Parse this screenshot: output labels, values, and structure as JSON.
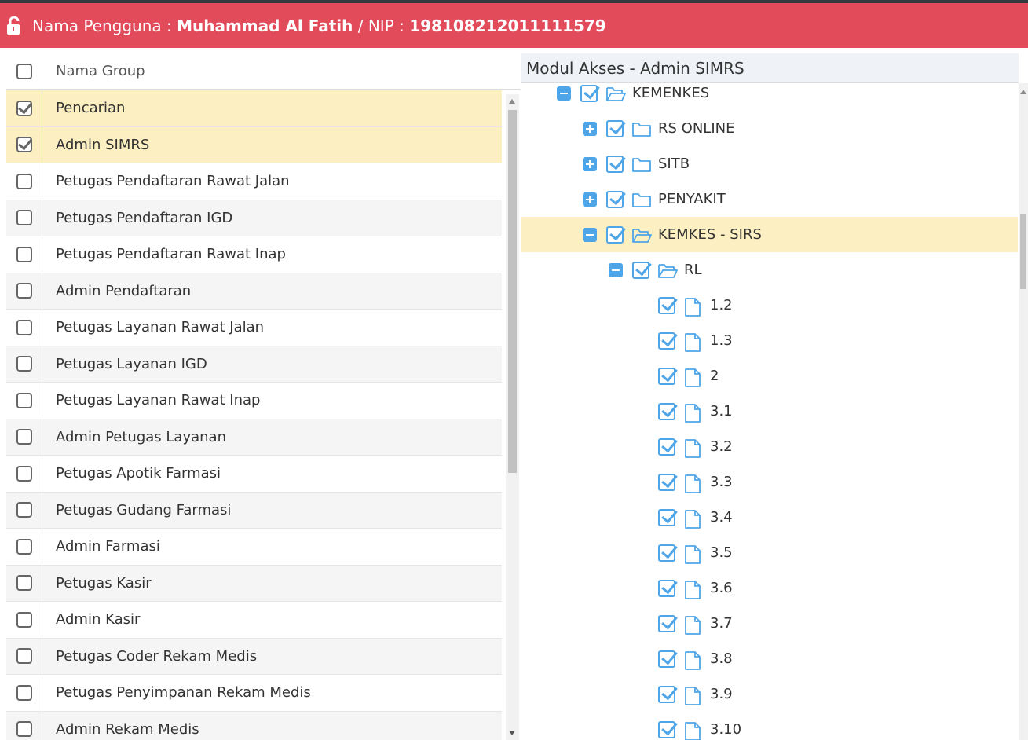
{
  "header": {
    "label_user": "Nama Pengguna : ",
    "user_name": "Muhammad Al Fatih",
    "label_nip": " / NIP : ",
    "nip": "198108212011111579",
    "brand_color": "#e14b5a"
  },
  "left": {
    "column_header": "Nama Group",
    "rows": [
      {
        "name": "Pencarian",
        "checked": true
      },
      {
        "name": "Admin SIMRS",
        "checked": true
      },
      {
        "name": "Petugas Pendaftaran Rawat Jalan",
        "checked": false
      },
      {
        "name": "Petugas Pendaftaran IGD",
        "checked": false
      },
      {
        "name": "Petugas Pendaftaran Rawat Inap",
        "checked": false
      },
      {
        "name": "Admin Pendaftaran",
        "checked": false
      },
      {
        "name": "Petugas Layanan Rawat Jalan",
        "checked": false
      },
      {
        "name": "Petugas Layanan IGD",
        "checked": false
      },
      {
        "name": "Petugas Layanan Rawat Inap",
        "checked": false
      },
      {
        "name": "Admin Petugas Layanan",
        "checked": false
      },
      {
        "name": "Petugas Apotik Farmasi",
        "checked": false
      },
      {
        "name": "Petugas Gudang Farmasi",
        "checked": false
      },
      {
        "name": "Admin Farmasi",
        "checked": false
      },
      {
        "name": "Petugas Kasir",
        "checked": false
      },
      {
        "name": "Admin Kasir",
        "checked": false
      },
      {
        "name": "Petugas Coder Rekam Medis",
        "checked": false
      },
      {
        "name": "Petugas Penyimpanan Rekam Medis",
        "checked": false
      },
      {
        "name": "Admin Rekam Medis",
        "checked": false
      }
    ]
  },
  "right": {
    "title": "Modul Akses - Admin SIMRS",
    "tree": [
      {
        "label": "KEMENKES",
        "level": 0,
        "toggle": "minus",
        "icon": "folder-open-icon",
        "selected": false
      },
      {
        "label": "RS ONLINE",
        "level": 1,
        "toggle": "plus",
        "icon": "folder-icon",
        "selected": false
      },
      {
        "label": "SITB",
        "level": 1,
        "toggle": "plus",
        "icon": "folder-icon",
        "selected": false
      },
      {
        "label": "PENYAKIT",
        "level": 1,
        "toggle": "plus",
        "icon": "folder-icon",
        "selected": false
      },
      {
        "label": "KEMKES - SIRS",
        "level": 1,
        "toggle": "minus",
        "icon": "folder-open-icon",
        "selected": true
      },
      {
        "label": "RL",
        "level": 2,
        "toggle": "minus",
        "icon": "folder-open-icon",
        "selected": false
      },
      {
        "label": "1.2",
        "level": 3,
        "toggle": "none",
        "icon": "file-icon",
        "selected": false
      },
      {
        "label": "1.3",
        "level": 3,
        "toggle": "none",
        "icon": "file-icon",
        "selected": false
      },
      {
        "label": "2",
        "level": 3,
        "toggle": "none",
        "icon": "file-icon",
        "selected": false
      },
      {
        "label": "3.1",
        "level": 3,
        "toggle": "none",
        "icon": "file-icon",
        "selected": false
      },
      {
        "label": "3.2",
        "level": 3,
        "toggle": "none",
        "icon": "file-icon",
        "selected": false
      },
      {
        "label": "3.3",
        "level": 3,
        "toggle": "none",
        "icon": "file-icon",
        "selected": false
      },
      {
        "label": "3.4",
        "level": 3,
        "toggle": "none",
        "icon": "file-icon",
        "selected": false
      },
      {
        "label": "3.5",
        "level": 3,
        "toggle": "none",
        "icon": "file-icon",
        "selected": false
      },
      {
        "label": "3.6",
        "level": 3,
        "toggle": "none",
        "icon": "file-icon",
        "selected": false
      },
      {
        "label": "3.7",
        "level": 3,
        "toggle": "none",
        "icon": "file-icon",
        "selected": false
      },
      {
        "label": "3.8",
        "level": 3,
        "toggle": "none",
        "icon": "file-icon",
        "selected": false
      },
      {
        "label": "3.9",
        "level": 3,
        "toggle": "none",
        "icon": "file-icon",
        "selected": false
      },
      {
        "label": "3.10",
        "level": 3,
        "toggle": "none",
        "icon": "file-icon",
        "selected": false
      }
    ]
  }
}
